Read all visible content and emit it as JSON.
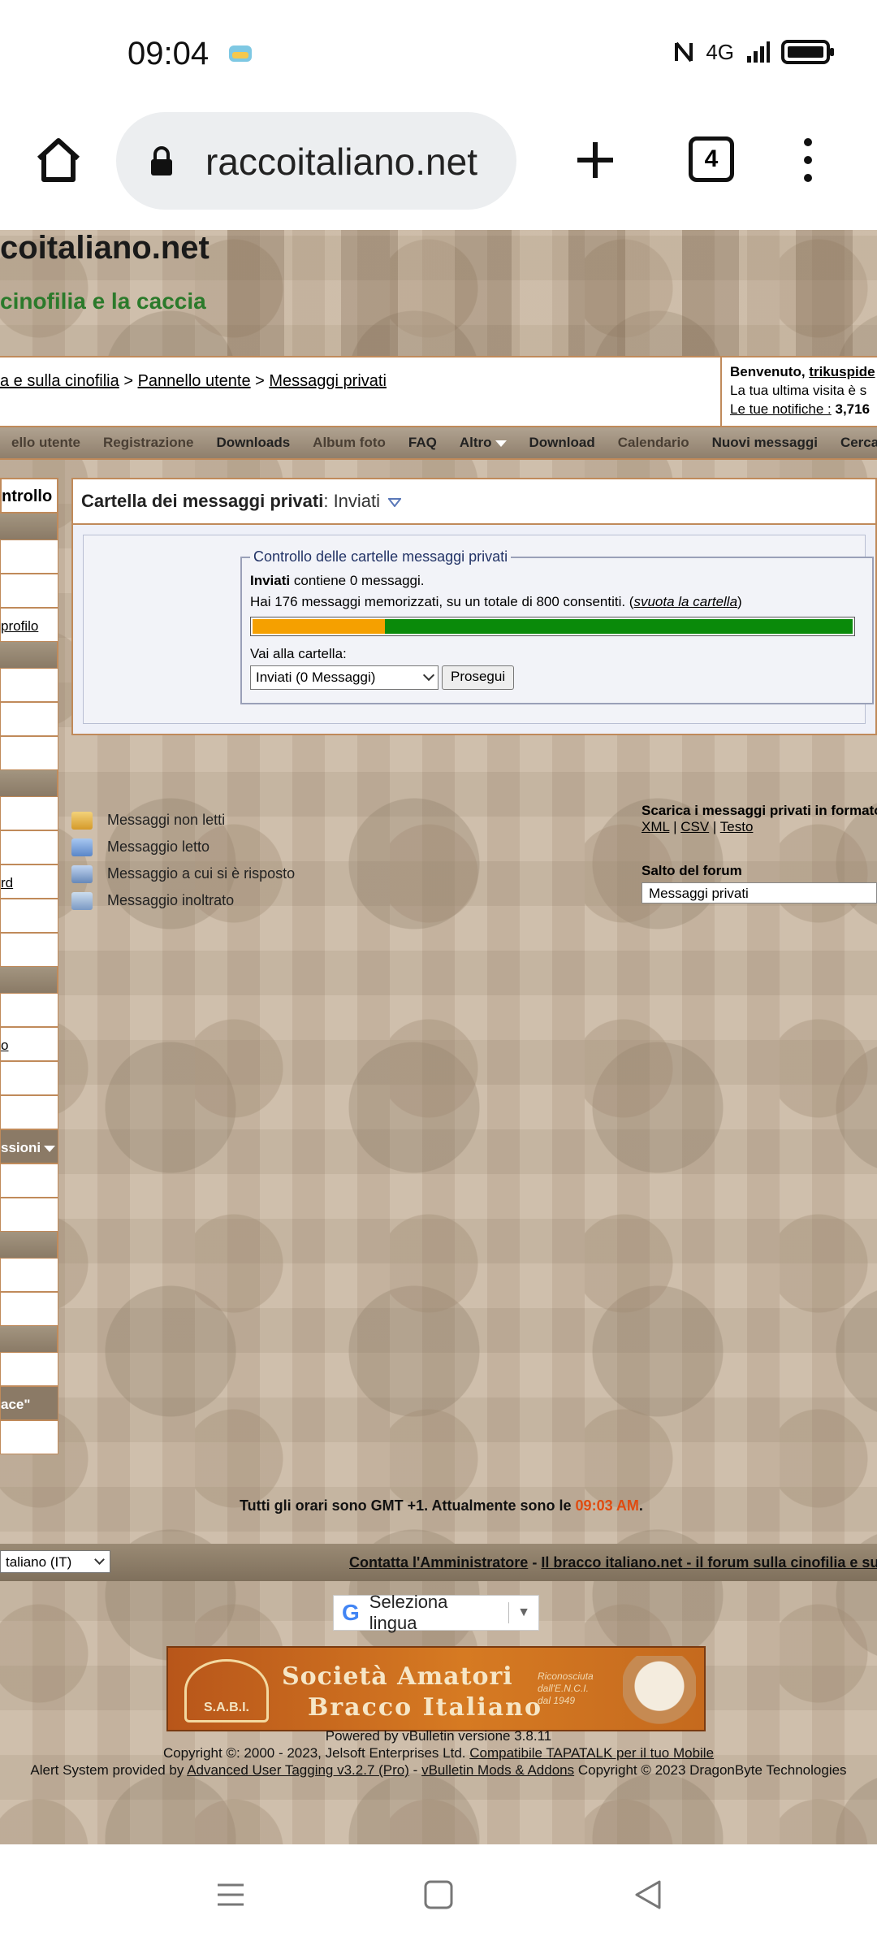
{
  "status_bar": {
    "time": "09:04",
    "network": "4G"
  },
  "browser": {
    "url": "raccoitaliano.net",
    "tab_count": "4"
  },
  "site": {
    "title": "coitaliano.net",
    "tagline": "cinofilia e la caccia"
  },
  "breadcrumb": {
    "part1": "a e sulla cinofilia",
    "sep": ">",
    "part2": "Pannello utente",
    "part3": "Messaggi privati"
  },
  "welcome": {
    "prefix": "Benvenuto,",
    "user": "trikuspide",
    "last_visit": "La tua ultima visita è s",
    "notifications_label": "Le tue notifiche :",
    "notifications_count": "3,716"
  },
  "nav": {
    "items": [
      "ello utente",
      "Registrazione",
      "Downloads",
      "Album foto",
      "FAQ",
      "Altro",
      "Download",
      "Calendario",
      "Nuovi messaggi",
      "Cerca"
    ]
  },
  "sidebar": {
    "header": "ntrollo",
    "profilo_link": "profilo",
    "rd_link": "rd",
    "o_link": "o",
    "sessioni_label": "ssioni",
    "place_label": "ace\""
  },
  "main": {
    "title_bold": "Cartella dei messaggi privati",
    "title_rest": ": Inviati",
    "fieldset_legend": "Controllo delle cartelle messaggi privati",
    "folder_name": "Inviati",
    "folder_text": "contiene 0 messaggi.",
    "quota_text": "Hai 176 messaggi memorizzati, su un totale di 800 consentiti. (",
    "empty_link": "svuota la cartella",
    "quota_close": ")",
    "quota_used_fraction": 0.22,
    "goto_label": "Vai alla cartella:",
    "goto_selected": "Inviati (0 Messaggi)",
    "go_button": "Prosegui"
  },
  "legend": {
    "unread": "Messaggi non letti",
    "read": "Messaggio letto",
    "replied": "Messaggio a cui si è risposto",
    "forwarded": "Messaggio inoltrato"
  },
  "export": {
    "label": "Scarica i messaggi privati in formato",
    "xml": "XML",
    "csv": "CSV",
    "text": "Testo",
    "sep": "|"
  },
  "jump": {
    "label": "Salto del forum",
    "selected": "Messaggi privati"
  },
  "timezone": {
    "text": "Tutti gli orari sono GMT +1. Attualmente sono le",
    "time": "09:03 AM",
    "end": "."
  },
  "footer": {
    "language": "taliano (IT)",
    "contact": "Contatta l'Amministratore",
    "dash": "-",
    "forum_link": "Il bracco italiano.net - il forum sulla cinofilia e sulla"
  },
  "translate": {
    "label": "Seleziona lingua",
    "arrow": "▼"
  },
  "banner": {
    "logo_text": "S.A.B.I.",
    "line1": "Società Amatori",
    "line2": "Bracco Italiano",
    "note": "Riconosciuta dall'E.N.C.I. dal 1949"
  },
  "credits": {
    "line1": "Powered by vBulletin versione 3.8.11",
    "line2_prefix": "Copyright ©: 2000 - 2023, Jelsoft Enterprises Ltd.",
    "line2_link": "Compatibile TAPATALK per il tuo Mobile",
    "line3_prefix": "Alert System provided by",
    "line3_link1": "Advanced User Tagging v3.2.7 (Pro)",
    "line3_dash": "-",
    "line3_link2": "vBulletin Mods & Addons",
    "line3_suffix": "Copyright © 2023 DragonByte Technologies"
  }
}
